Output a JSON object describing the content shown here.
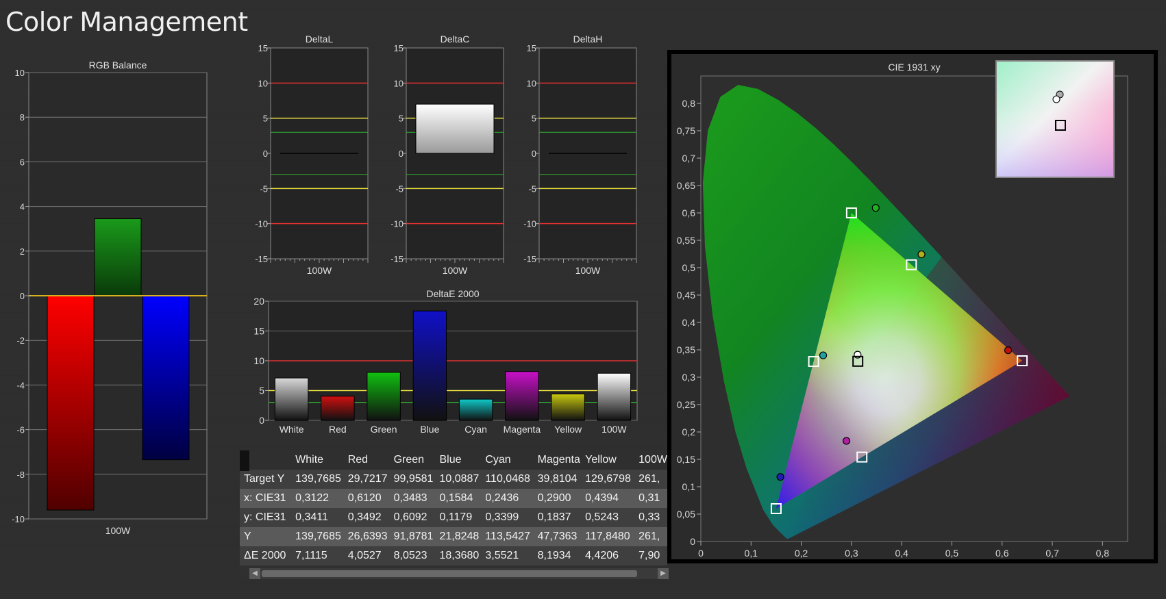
{
  "page_title": "Color Management",
  "colors": {
    "red_line": "#e03030",
    "yellow_line": "#e8e040",
    "green_line": "#30b030",
    "gold_line": "#d8b020"
  },
  "chart_data": [
    {
      "type": "bar",
      "title": "RGB Balance",
      "categories": [
        "100W"
      ],
      "series": [
        {
          "values": [
            -9.6
          ],
          "color": "#ff0000"
        },
        {
          "values": [
            3.45
          ],
          "color": "#1a9a1a"
        },
        {
          "values": [
            -7.35
          ],
          "color": "#0000ff"
        }
      ],
      "ylim": [
        -10,
        10
      ],
      "yticks": [
        -10,
        -8,
        -6,
        -4,
        -2,
        0,
        2,
        4,
        6,
        8,
        10
      ]
    },
    {
      "type": "bar",
      "title": "DeltaL",
      "categories": [
        "100W"
      ],
      "values": [
        0
      ],
      "ylim": [
        -15,
        15
      ],
      "yticks": [
        -15,
        -10,
        -5,
        0,
        5,
        10,
        15
      ],
      "reference_lines": [
        {
          "y": 10,
          "color": "red"
        },
        {
          "y": -10,
          "color": "red"
        },
        {
          "y": 5,
          "color": "yellow"
        },
        {
          "y": -5,
          "color": "yellow"
        },
        {
          "y": 3,
          "color": "green"
        },
        {
          "y": -3,
          "color": "green"
        }
      ]
    },
    {
      "type": "bar",
      "title": "DeltaC",
      "categories": [
        "100W"
      ],
      "values": [
        7.0
      ],
      "ylim": [
        -15,
        15
      ],
      "yticks": [
        -15,
        -10,
        -5,
        0,
        5,
        10,
        15
      ],
      "reference_lines": [
        {
          "y": 10,
          "color": "red"
        },
        {
          "y": -10,
          "color": "red"
        },
        {
          "y": 5,
          "color": "yellow"
        },
        {
          "y": -5,
          "color": "yellow"
        },
        {
          "y": 3,
          "color": "green"
        },
        {
          "y": -3,
          "color": "green"
        }
      ]
    },
    {
      "type": "bar",
      "title": "DeltaH",
      "categories": [
        "100W"
      ],
      "values": [
        0
      ],
      "ylim": [
        -15,
        15
      ],
      "yticks": [
        -15,
        -10,
        -5,
        0,
        5,
        10,
        15
      ],
      "reference_lines": [
        {
          "y": 10,
          "color": "red"
        },
        {
          "y": -10,
          "color": "red"
        },
        {
          "y": 5,
          "color": "yellow"
        },
        {
          "y": -5,
          "color": "yellow"
        },
        {
          "y": 3,
          "color": "green"
        },
        {
          "y": -3,
          "color": "green"
        }
      ]
    },
    {
      "type": "bar",
      "title": "DeltaE 2000",
      "categories": [
        "White",
        "Red",
        "Green",
        "Blue",
        "Cyan",
        "Magenta",
        "Yellow",
        "100W"
      ],
      "values": [
        7.1115,
        4.0527,
        8.0523,
        18.368,
        3.5521,
        8.1934,
        4.4206,
        7.9
      ],
      "bar_colors": [
        "#d8d8d8",
        "#d01010",
        "#10c010",
        "#1010c8",
        "#10c8c8",
        "#c810c8",
        "#c8c810",
        "#ffffff"
      ],
      "ylim": [
        0,
        20
      ],
      "yticks": [
        0,
        5,
        10,
        15,
        20
      ],
      "reference_lines": [
        {
          "y": 10,
          "color": "red"
        },
        {
          "y": 5,
          "color": "yellow"
        },
        {
          "y": 3,
          "color": "green"
        }
      ]
    },
    {
      "type": "scatter",
      "title": "CIE 1931 xy",
      "xlim": [
        0,
        0.85
      ],
      "ylim": [
        0,
        0.85
      ],
      "xticks": [
        "0",
        "0,1",
        "0,2",
        "0,3",
        "0,4",
        "0,5",
        "0,6",
        "0,7",
        "0,8"
      ],
      "yticks": [
        "0",
        "0,05",
        "0,1",
        "0,15",
        "0,2",
        "0,25",
        "0,3",
        "0,35",
        "0,4",
        "0,45",
        "0,5",
        "0,55",
        "0,6",
        "0,65",
        "0,7",
        "0,75",
        "0,8"
      ],
      "targets": [
        {
          "name": "Red",
          "x": 0.64,
          "y": 0.33
        },
        {
          "name": "Green",
          "x": 0.3,
          "y": 0.6
        },
        {
          "name": "Blue",
          "x": 0.15,
          "y": 0.06
        },
        {
          "name": "Cyan",
          "x": 0.2246,
          "y": 0.3287
        },
        {
          "name": "Magenta",
          "x": 0.3209,
          "y": 0.1542
        },
        {
          "name": "Yellow",
          "x": 0.4193,
          "y": 0.5053
        },
        {
          "name": "White",
          "x": 0.3127,
          "y": 0.329
        }
      ],
      "measured": [
        {
          "name": "Red",
          "x": 0.612,
          "y": 0.3492
        },
        {
          "name": "Green",
          "x": 0.3483,
          "y": 0.6092
        },
        {
          "name": "Blue",
          "x": 0.1584,
          "y": 0.1179
        },
        {
          "name": "Cyan",
          "x": 0.2436,
          "y": 0.3399
        },
        {
          "name": "Magenta",
          "x": 0.29,
          "y": 0.1837
        },
        {
          "name": "Yellow",
          "x": 0.4394,
          "y": 0.5243
        },
        {
          "name": "White",
          "x": 0.3122,
          "y": 0.3411
        }
      ]
    }
  ],
  "table": {
    "columns": [
      "",
      "White",
      "Red",
      "Green",
      "Blue",
      "Cyan",
      "Magenta",
      "Yellow",
      "100W"
    ],
    "rows": [
      [
        "Target Y",
        "139,7685",
        "29,7217",
        "99,9581",
        "10,0887",
        "110,0468",
        "39,8104",
        "129,6798",
        "261,"
      ],
      [
        "x: CIE31",
        "0,3122",
        "0,6120",
        "0,3483",
        "0,1584",
        "0,2436",
        "0,2900",
        "0,4394",
        "0,31"
      ],
      [
        "y: CIE31",
        "0,3411",
        "0,3492",
        "0,6092",
        "0,1179",
        "0,3399",
        "0,1837",
        "0,5243",
        "0,33"
      ],
      [
        "Y",
        "139,7685",
        "26,6393",
        "91,8781",
        "21,8248",
        "113,5427",
        "47,7363",
        "117,8480",
        "261,"
      ],
      [
        "ΔE 2000",
        "7,1115",
        "4,0527",
        "8,0523",
        "18,3680",
        "3,5521",
        "8,1934",
        "4,4206",
        "7,90"
      ]
    ]
  }
}
